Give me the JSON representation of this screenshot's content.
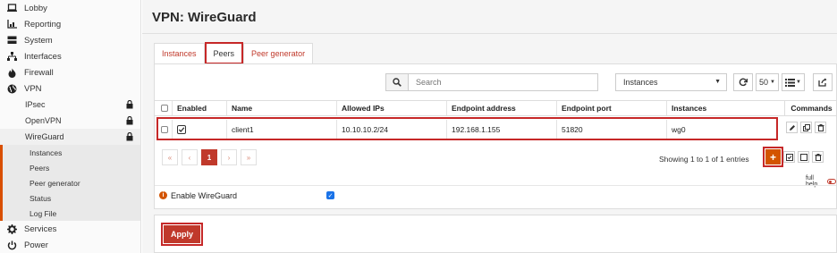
{
  "sidebar": {
    "items": [
      {
        "label": "Lobby",
        "icon": "laptop-icon"
      },
      {
        "label": "Reporting",
        "icon": "chart-icon"
      },
      {
        "label": "System",
        "icon": "server-icon"
      },
      {
        "label": "Interfaces",
        "icon": "sitemap-icon"
      },
      {
        "label": "Firewall",
        "icon": "fire-icon"
      },
      {
        "label": "VPN",
        "icon": "globe-icon"
      }
    ],
    "vpn_sub": [
      "IPsec",
      "OpenVPN",
      "WireGuard"
    ],
    "wireguard_sub": [
      "Instances",
      "Peers",
      "Peer generator",
      "Status",
      "Log File"
    ],
    "bottom_items": [
      {
        "label": "Services",
        "icon": "gear-icon"
      },
      {
        "label": "Power",
        "icon": "power-icon"
      }
    ]
  },
  "page": {
    "title": "VPN: WireGuard"
  },
  "tabs": [
    "Instances",
    "Peers",
    "Peer generator"
  ],
  "toolbar": {
    "search_placeholder": "Search",
    "instances_label": "Instances",
    "page_size": "50"
  },
  "table": {
    "headers": [
      "Enabled",
      "Name",
      "Allowed IPs",
      "Endpoint address",
      "Endpoint port",
      "Instances",
      "Commands"
    ],
    "rows": [
      {
        "enabled": true,
        "name": "client1",
        "allowed_ips": "10.10.10.2/24",
        "endpoint_address": "192.168.1.155",
        "endpoint_port": "51820",
        "instances": "wg0"
      }
    ]
  },
  "pager": {
    "first": "«",
    "prev": "‹",
    "current": "1",
    "next": "›",
    "last": "»",
    "showing": "Showing 1 to 1 of 1 entries"
  },
  "full_help": "full help",
  "enable": {
    "label": "Enable WireGuard",
    "checked": true
  },
  "apply_label": "Apply",
  "colors": {
    "accent": "#c0392b",
    "highlight": "#c62828",
    "orange": "#d35400"
  }
}
